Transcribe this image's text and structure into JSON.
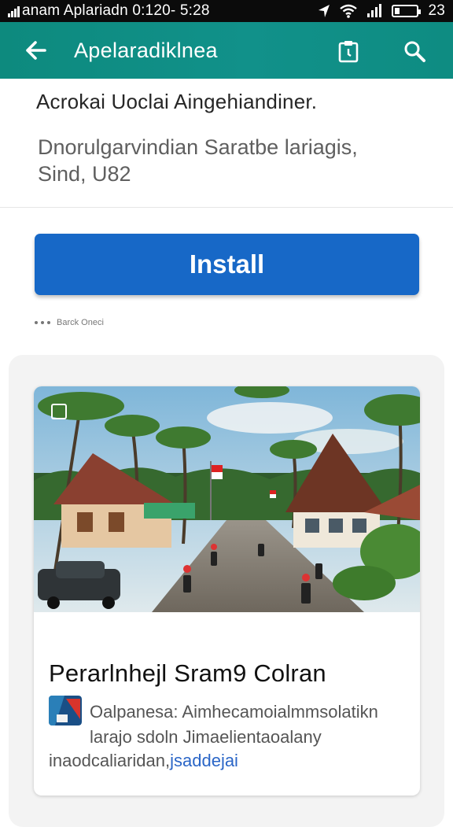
{
  "status_bar": {
    "carrier_time": "anam Aplariadn 0:120- 5:28",
    "battery_text": "23",
    "battery_level": 0.23
  },
  "app_bar": {
    "title": "Apelaradiklnea",
    "back_icon": "arrow-left-icon",
    "actions": [
      "clipboard-icon",
      "search-icon"
    ]
  },
  "header": {
    "heading": "Acrokai Uoclai Aingehiandiner.",
    "subheading_line1": "Dnorulgarvindian Saratbe lariagis,",
    "subheading_line2": "Sind, U82"
  },
  "install": {
    "label": "Install",
    "meta": "Barck Oneci"
  },
  "card": {
    "title": "Perarlnhejl Sram9 Colran",
    "desc_line1": "Oalpanesa: Aimhecamoialmmsolatikn",
    "desc_line2": "larajo sdoln Jimaelientaoalany",
    "desc_line3": "inaodcaliaridan,",
    "desc_link": "jsaddejai"
  },
  "colors": {
    "app_bar": "#0e8c82",
    "install": "#1768c7",
    "link": "#2b66c7"
  }
}
